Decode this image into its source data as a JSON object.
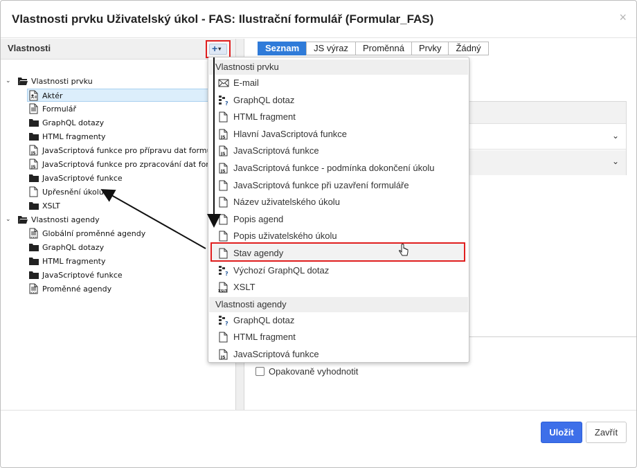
{
  "dialog": {
    "title": "Vlastnosti prvku Uživatelský úkol - FAS: Ilustrační formulář (Formular_FAS)",
    "close_glyph": "×"
  },
  "left_panel": {
    "header": "Vlastnosti",
    "add_glyph": "+",
    "add_caret": "▾",
    "tree": [
      {
        "label": "Vlastnosti prvku",
        "icon": "folder-open-icon",
        "level": 0,
        "toggle": "expanded"
      },
      {
        "label": "Aktér",
        "icon": "actor-doc-icon",
        "level": 1,
        "selected": true
      },
      {
        "label": "Formulář",
        "icon": "form-doc-icon",
        "level": 1
      },
      {
        "label": "GraphQL dotazy",
        "icon": "folder-icon",
        "level": 1
      },
      {
        "label": "HTML fragmenty",
        "icon": "folder-icon",
        "level": 1
      },
      {
        "label": "JavaScriptová funkce pro přípravu dat formuláře",
        "icon": "js-file-icon",
        "level": 1
      },
      {
        "label": "JavaScriptová funkce pro zpracování dat formuláře",
        "icon": "js-file-icon",
        "level": 1
      },
      {
        "label": "JavaScriptové funkce",
        "icon": "folder-icon",
        "level": 1
      },
      {
        "label": "Upřesnění úkolu",
        "icon": "file-icon",
        "level": 1
      },
      {
        "label": "XSLT",
        "icon": "folder-icon",
        "level": 1
      },
      {
        "label": "Vlastnosti agendy",
        "icon": "folder-open-icon",
        "level": 0,
        "toggle": "expanded"
      },
      {
        "label": "Globální proměnné agendy",
        "icon": "variables-doc-icon",
        "level": 1
      },
      {
        "label": "GraphQL dotazy",
        "icon": "folder-icon",
        "level": 1
      },
      {
        "label": "HTML fragmenty",
        "icon": "folder-icon",
        "level": 1
      },
      {
        "label": "JavaScriptové funkce",
        "icon": "folder-icon",
        "level": 1
      },
      {
        "label": "Proměnné agendy",
        "icon": "variables-doc-icon",
        "level": 1
      }
    ]
  },
  "tabs": [
    {
      "label": "Seznam",
      "active": true
    },
    {
      "label": "JS výraz",
      "active": false
    },
    {
      "label": "Proměnná",
      "active": false
    },
    {
      "label": "Prvky",
      "active": false
    },
    {
      "label": "Žádný",
      "active": false
    }
  ],
  "right_panel": {
    "chevron": "⌄",
    "checkbox_label": "Opakovaně vyhodnotit"
  },
  "dropdown": {
    "groups": [
      {
        "label": "Vlastnosti prvku",
        "items": [
          {
            "label": "E-mail",
            "icon": "envelope-icon"
          },
          {
            "label": "GraphQL dotaz",
            "icon": "graphql-icon"
          },
          {
            "label": "HTML fragment",
            "icon": "file-icon"
          },
          {
            "label": "Hlavní JavaScriptová funkce",
            "icon": "js-file-icon"
          },
          {
            "label": "JavaScriptová funkce",
            "icon": "js-file-icon"
          },
          {
            "label": "JavaScriptová funkce - podmínka dokončení úkolu",
            "icon": "js-file-icon"
          },
          {
            "label": "JavaScriptová funkce při uzavření formuláře",
            "icon": "file-icon"
          },
          {
            "label": "Název uživatelského úkolu",
            "icon": "file-icon"
          },
          {
            "label": "Popis agend",
            "icon": "file-icon"
          },
          {
            "label": "Popis uživatelského úkolu",
            "icon": "file-icon"
          },
          {
            "label": "Stav agendy",
            "icon": "file-icon",
            "highlighted": true
          },
          {
            "label": "Výchozí GraphQL dotaz",
            "icon": "graphql-icon"
          },
          {
            "label": "XSLT",
            "icon": "xslt-file-icon"
          }
        ]
      },
      {
        "label": "Vlastnosti agendy",
        "items": [
          {
            "label": "GraphQL dotaz",
            "icon": "graphql-icon"
          },
          {
            "label": "HTML fragment",
            "icon": "file-icon"
          },
          {
            "label": "JavaScriptová funkce",
            "icon": "js-file-icon"
          }
        ]
      }
    ]
  },
  "footer": {
    "save_label": "Uložit",
    "close_label": "Zavřít"
  },
  "colors": {
    "accent": "#3d6fe9",
    "tab_active": "#2f7bd9",
    "annotation_red": "#e01e1e"
  }
}
